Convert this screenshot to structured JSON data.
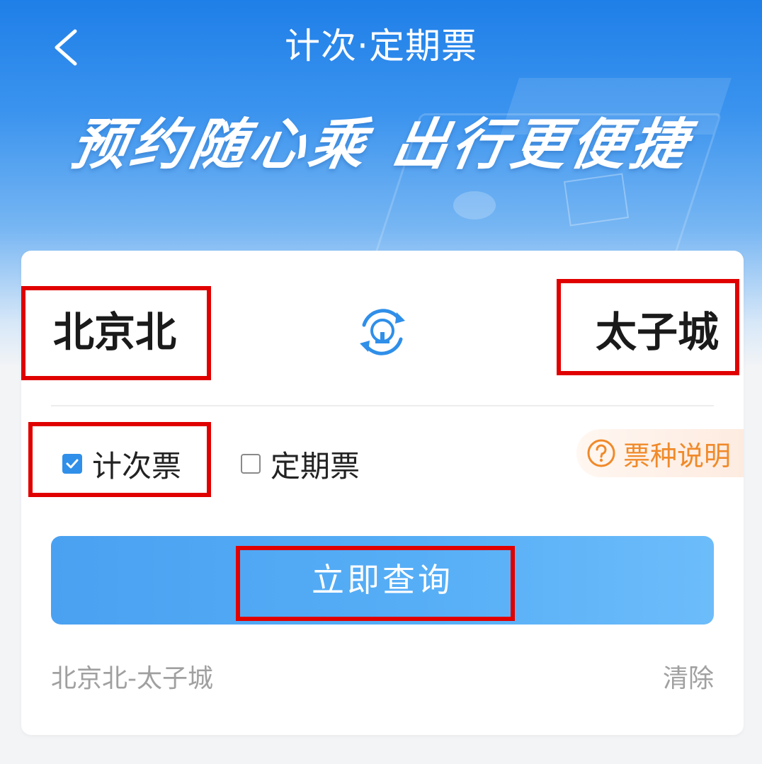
{
  "header": {
    "title": "计次·定期票",
    "back_icon": "chevron-left-icon"
  },
  "banner": {
    "slogan": "预约随心乘 出行更便捷"
  },
  "route": {
    "from_station": "北京北",
    "to_station": "太子城",
    "swap_icon": "swap-stations-icon"
  },
  "ticket_types": [
    {
      "label": "计次票",
      "checked": true
    },
    {
      "label": "定期票",
      "checked": false
    }
  ],
  "ticket_help": {
    "label": "票种说明",
    "icon": "question-circle-icon"
  },
  "query_button": {
    "label": "立即查询"
  },
  "history": {
    "item": "北京北-太子城",
    "clear_label": "清除"
  },
  "colors": {
    "primary_blue": "#2f8fe9",
    "button_blue": "#56aef6",
    "help_orange": "#f08a2a",
    "highlight_red": "#e00000"
  }
}
